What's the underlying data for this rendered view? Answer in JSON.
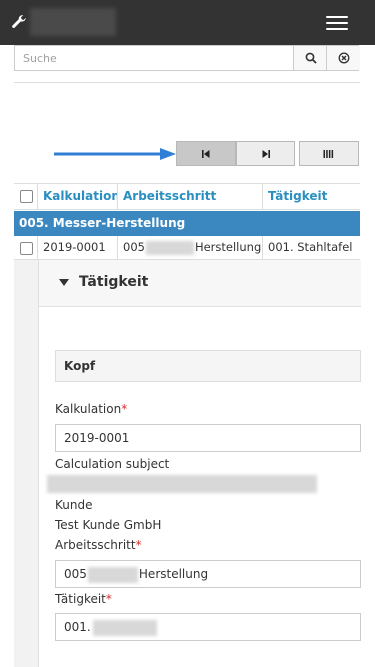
{
  "topbar": {
    "icon": "wrench-icon",
    "menu_icon": "hamburger-icon"
  },
  "search": {
    "placeholder": "Suche",
    "search_icon": "search-icon",
    "clear_icon": "clear-circle-icon"
  },
  "pager": {
    "first_icon": "first-page-icon",
    "last_icon": "last-page-icon",
    "columns_icon": "columns-icon"
  },
  "table": {
    "headers": [
      "Kalkulation",
      "Arbeitsschritt",
      "Tätigkeit"
    ],
    "group_label": "005. Messer-Herstellung",
    "row": {
      "kalkulation": "2019-0001",
      "arbeitsschritt_prefix": "005",
      "arbeitsschritt_suffix": "Herstellung",
      "taetigkeit": "001. Stahltafel"
    }
  },
  "detail": {
    "section_title": "Tätigkeit",
    "panel_title": "Kopf",
    "fields": {
      "kalkulation_label": "Kalkulation",
      "kalkulation_value": "2019-0001",
      "calc_subject_label": "Calculation subject",
      "kunde_label": "Kunde",
      "kunde_value": "Test Kunde GmbH",
      "arbeitsschritt_label": "Arbeitsschritt",
      "arbeitsschritt_prefix": "005",
      "arbeitsschritt_suffix": "Herstellung",
      "taetigkeit_label": "Tätigkeit",
      "taetigkeit_prefix": "001."
    },
    "required_mark": "*"
  },
  "colors": {
    "topbar": "#333333",
    "accent": "#2a8fc0",
    "group_bg": "#3b88c0",
    "arrow": "#2f7fd6",
    "required": "#d32f2f"
  }
}
